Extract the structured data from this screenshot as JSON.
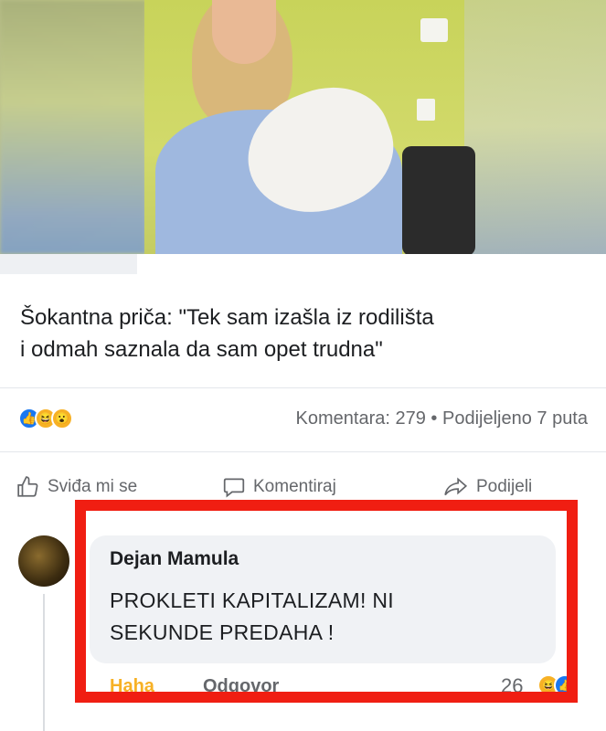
{
  "post": {
    "title_line1": "Šokantna priča: \"Tek sam izašla iz rodilišta",
    "title_line2": "i odmah saznala da sam opet trudna\"",
    "reactions_icons": [
      "like-icon",
      "haha-icon",
      "wow-icon"
    ],
    "stats": "Komentara: 279 • Podijeljeno 7 puta"
  },
  "actions": {
    "like": "Sviđa mi se",
    "comment": "Komentiraj",
    "share": "Podijeli"
  },
  "comment": {
    "author": "Dejan Mamula",
    "text_line1": "PROKLETI KAPITALIZAM! NI",
    "text_line2": "SEKUNDE PREDAHA !",
    "reaction_label": "Haha",
    "reply_label": "Odgovor",
    "reaction_count": "26",
    "reaction_icons": [
      "haha-icon",
      "like-icon"
    ]
  },
  "colors": {
    "highlight_box": "#f01e12",
    "haha_active": "#f7b125",
    "facebook_blue": "#1877f2"
  }
}
